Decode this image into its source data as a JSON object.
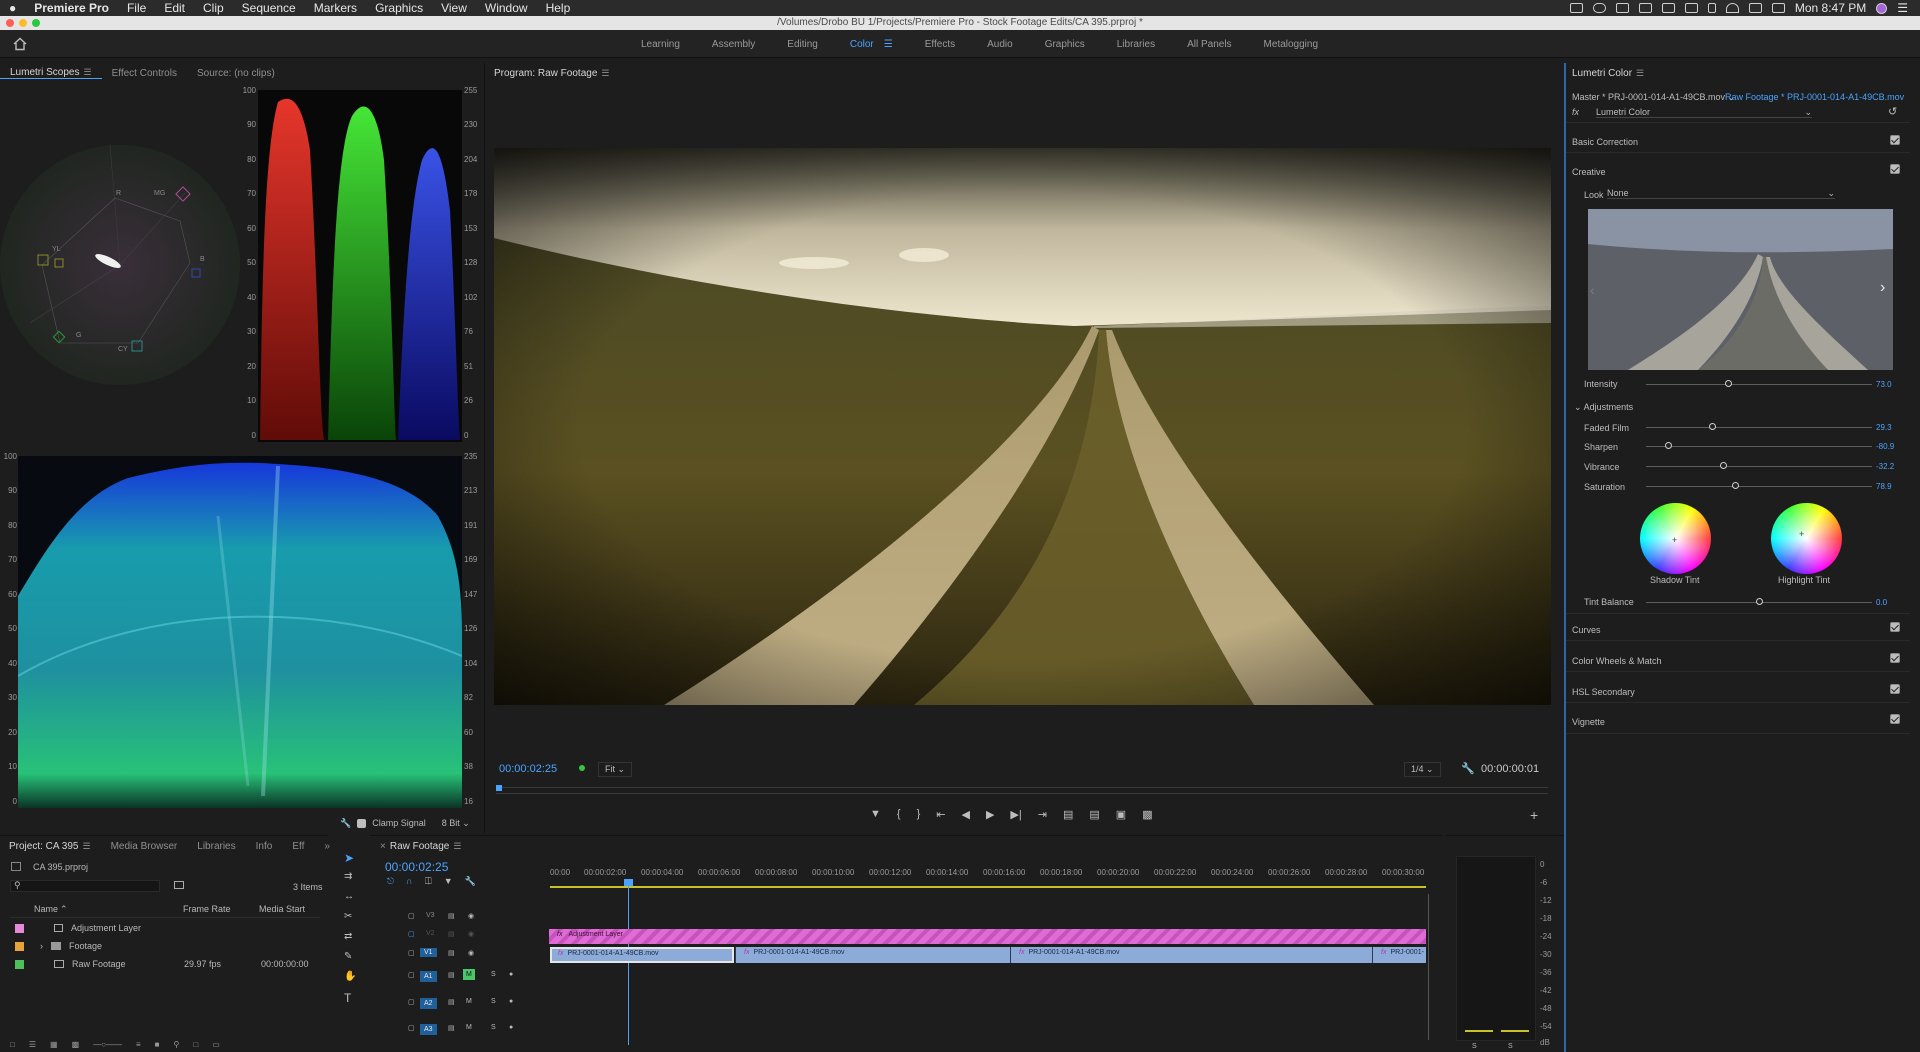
{
  "menubar": {
    "apple": "",
    "app": "Premiere Pro",
    "items": [
      "File",
      "Edit",
      "Clip",
      "Sequence",
      "Markers",
      "Graphics",
      "View",
      "Window",
      "Help"
    ],
    "clock": "Mon 8:47 PM"
  },
  "window": {
    "title": "/Volumes/Drobo BU 1/Projects/Premiere Pro - Stock Footage Edits/CA 395.prproj *"
  },
  "workspaces": {
    "tabs": [
      "Learning",
      "Assembly",
      "Editing",
      "Color",
      "Effects",
      "Audio",
      "Graphics",
      "Libraries",
      "All Panels",
      "Metalogging"
    ],
    "active": "Color"
  },
  "scopes_panel": {
    "tabs": [
      "Lumetri Scopes",
      "Effect Controls",
      "Source: (no clips)"
    ],
    "parade_left_scale": [
      "100",
      "90",
      "80",
      "70",
      "60",
      "50",
      "40",
      "30",
      "20",
      "10",
      "0"
    ],
    "parade_right_scale": [
      "255",
      "230",
      "204",
      "178",
      "153",
      "128",
      "102",
      "76",
      "51",
      "26",
      "0"
    ],
    "waveform_left_scale": [
      "100",
      "90",
      "80",
      "70",
      "60",
      "50",
      "40",
      "30",
      "20",
      "10",
      "0"
    ],
    "waveform_right_scale": [
      "235",
      "213",
      "191",
      "169",
      "147",
      "126",
      "104",
      "82",
      "60",
      "38",
      "16"
    ],
    "vector_labels": [
      "R",
      "MG",
      "B",
      "CY",
      "G",
      "YL"
    ],
    "clamp_signal": "Clamp Signal",
    "bit_depth": "8 Bit"
  },
  "program": {
    "title": "Program: Raw Footage",
    "timecode": "00:00:02:25",
    "fit": "Fit",
    "resolution": "1/4",
    "duration": "00:00:00:01"
  },
  "lumetri": {
    "title": "Lumetri Color",
    "master": "Master * PRJ-0001-014-A1-49CB.mov",
    "clip": "Raw Footage * PRJ-0001-014-A1-49CB.mov",
    "fx": "fx",
    "effect": "Lumetri Color",
    "sections": {
      "basic": "Basic Correction",
      "creative": "Creative",
      "curves": "Curves",
      "wheels": "Color Wheels & Match",
      "hsl": "HSL Secondary",
      "vignette": "Vignette"
    },
    "look_label": "Look",
    "look_value": "None",
    "intensity_label": "Intensity",
    "intensity": "73.0",
    "intensity_level": 0.365,
    "adjustments_label": "Adjustments",
    "sliders": [
      {
        "label": "Faded Film",
        "value": "29.3",
        "level": 0.293
      },
      {
        "label": "Sharpen",
        "value": "-80.9",
        "level": 0.096
      },
      {
        "label": "Vibrance",
        "value": "-32.2",
        "level": 0.339
      },
      {
        "label": "Saturation",
        "value": "78.9",
        "level": 0.395
      }
    ],
    "shadow_tint": "Shadow Tint",
    "highlight_tint": "Highlight Tint",
    "tint_balance_label": "Tint Balance",
    "tint_balance": "0.0",
    "tint_balance_level": 0.5
  },
  "project": {
    "tabs": [
      "Project: CA 395",
      "Media Browser",
      "Libraries",
      "Info",
      "Eff"
    ],
    "file": "CA 395.prproj",
    "items_count": "3 Items",
    "columns": [
      "Name",
      "Frame Rate",
      "Media Start"
    ],
    "rows": [
      {
        "name": "Adjustment Layer",
        "color": "#e48ad8",
        "fps": "",
        "start": ""
      },
      {
        "name": "Footage",
        "color": "#e5a33a",
        "fps": "",
        "start": ""
      },
      {
        "name": "Raw Footage",
        "color": "#4fbf5a",
        "fps": "29.97 fps",
        "start": "00:00:00:00"
      }
    ]
  },
  "timeline": {
    "title": "Raw Footage",
    "timecode": "00:00:02:25",
    "ruler": [
      "00:00",
      "00:00:02:00",
      "00:00:04:00",
      "00:00:06:00",
      "00:00:08:00",
      "00:00:10:00",
      "00:00:12:00",
      "00:00:14:00",
      "00:00:16:00",
      "00:00:18:00",
      "00:00:20:00",
      "00:00:22:00",
      "00:00:24:00",
      "00:00:26:00",
      "00:00:28:00",
      "00:00:30:00"
    ],
    "tracks": [
      "V3",
      "V2",
      "V1",
      "A1",
      "A2",
      "A3"
    ],
    "adjustment_clip": "Adjustment Layer",
    "clips": [
      "PRJ-0001-014-A1-49CB.mov",
      "PRJ-0001-014-A1-49CB.mov",
      "PRJ-0001-014-A1-49CB.mov",
      "PRJ-0001-"
    ],
    "track_buttons": {
      "mute": "M",
      "solo": "S"
    }
  },
  "meter": {
    "scale": [
      "0",
      "-6",
      "-12",
      "-18",
      "-24",
      "-30",
      "-36",
      "-42",
      "-48",
      "-54",
      "dB"
    ],
    "solo": [
      "S",
      "S"
    ]
  }
}
